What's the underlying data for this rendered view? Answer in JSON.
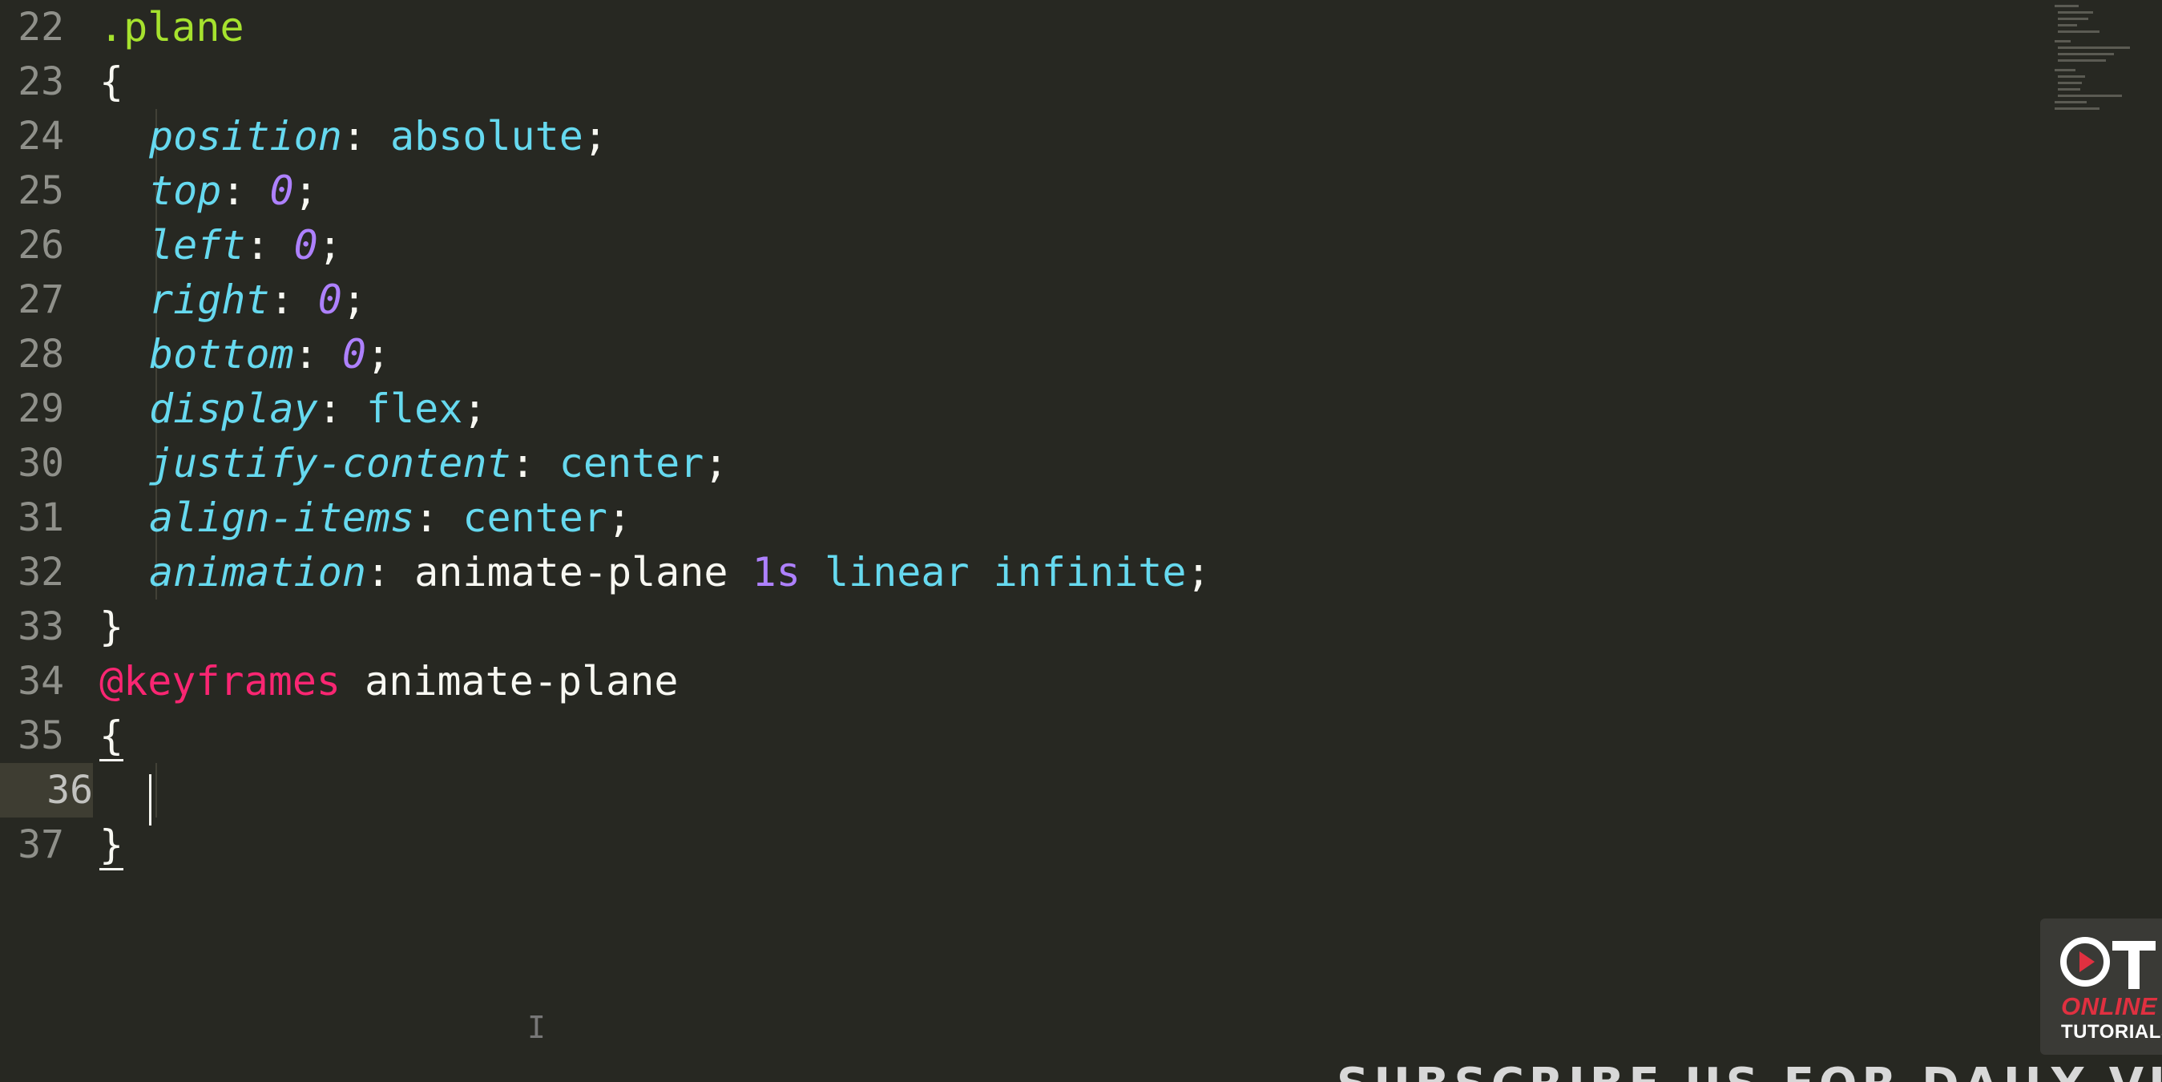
{
  "editor": {
    "theme_colors": {
      "background": "#272822",
      "selector": "#a6e22e",
      "property": "#66d9ef",
      "number": "#ae81ff",
      "at_rule": "#f92672",
      "text": "#f8f8f2"
    },
    "line_numbers": [
      "22",
      "23",
      "24",
      "25",
      "26",
      "27",
      "28",
      "29",
      "30",
      "31",
      "32",
      "33",
      "34",
      "35",
      "36",
      "37"
    ],
    "active_line": "36",
    "code": {
      "l22": {
        "selector": ".plane"
      },
      "l23": {
        "brace": "{"
      },
      "l24": {
        "prop": "position",
        "colon": ": ",
        "value": "absolute",
        "semi": ";"
      },
      "l25": {
        "prop": "top",
        "colon": ": ",
        "value": "0",
        "semi": ";"
      },
      "l26": {
        "prop": "left",
        "colon": ": ",
        "value": "0",
        "semi": ";"
      },
      "l27": {
        "prop": "right",
        "colon": ": ",
        "value": "0",
        "semi": ";"
      },
      "l28": {
        "prop": "bottom",
        "colon": ": ",
        "value": "0",
        "semi": ";"
      },
      "l29": {
        "prop": "display",
        "colon": ": ",
        "value": "flex",
        "semi": ";"
      },
      "l30": {
        "prop": "justify-content",
        "colon": ": ",
        "value": "center",
        "semi": ";"
      },
      "l31": {
        "prop": "align-items",
        "colon": ": ",
        "value": "center",
        "semi": ";"
      },
      "l32": {
        "prop": "animation",
        "colon": ": ",
        "name": "animate-plane",
        "duration": "1s",
        "timing": "linear",
        "iteration": "infinite",
        "semi": ";"
      },
      "l33": {
        "brace": "}"
      },
      "l34": {
        "at_rule": "@keyframes",
        "name": "animate-plane"
      },
      "l35": {
        "brace": "{"
      },
      "l37": {
        "brace": "}"
      }
    }
  },
  "logo": {
    "mark": "OT",
    "line1": "ONLINE",
    "line2": "TUTORIALS"
  },
  "banner": {
    "text": "SUBSCRIBE US FOR DAILY VIDEOS"
  }
}
